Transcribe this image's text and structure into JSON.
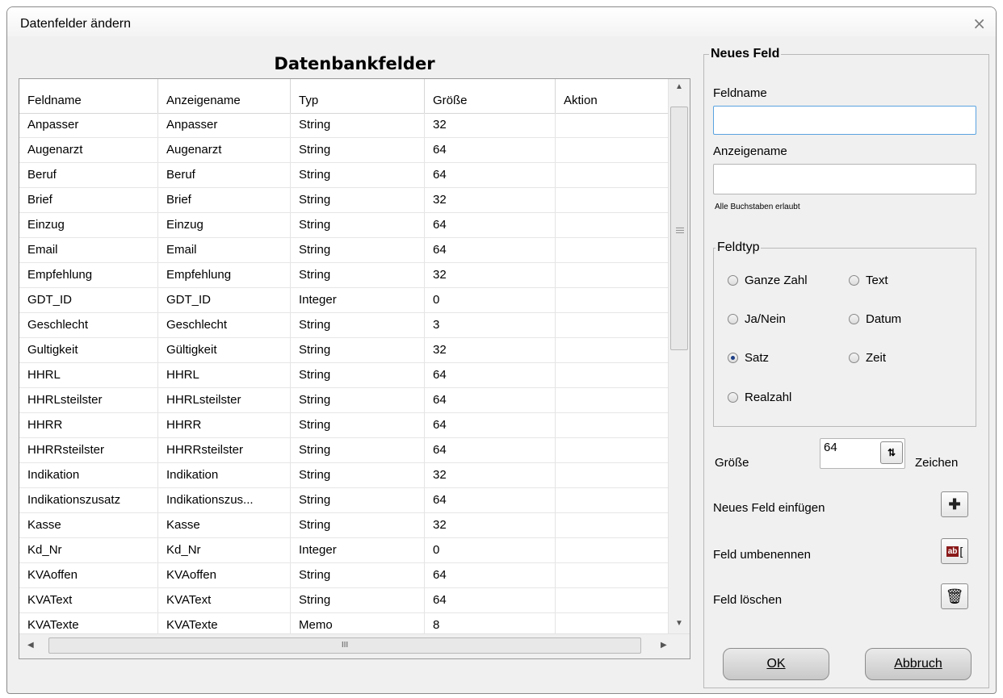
{
  "window": {
    "title": "Datenfelder ändern",
    "close": "×"
  },
  "section_title": "Datenbankfelder",
  "columns": [
    "Feldname",
    "Anzeigename",
    "Typ",
    "Größe",
    "Aktion"
  ],
  "rows": [
    [
      "Anpasser",
      "Anpasser",
      "String",
      "32",
      ""
    ],
    [
      "Augenarzt",
      "Augenarzt",
      "String",
      "64",
      ""
    ],
    [
      "Beruf",
      "Beruf",
      "String",
      "64",
      ""
    ],
    [
      "Brief",
      "Brief",
      "String",
      "32",
      ""
    ],
    [
      "Einzug",
      "Einzug",
      "String",
      "64",
      ""
    ],
    [
      "Email",
      "Email",
      "String",
      "64",
      ""
    ],
    [
      "Empfehlung",
      "Empfehlung",
      "String",
      "32",
      ""
    ],
    [
      "GDT_ID",
      "GDT_ID",
      "Integer",
      "0",
      ""
    ],
    [
      "Geschlecht",
      "Geschlecht",
      "String",
      "3",
      ""
    ],
    [
      "Gultigkeit",
      "Gültigkeit",
      "String",
      "32",
      ""
    ],
    [
      "HHRL",
      "HHRL",
      "String",
      "64",
      ""
    ],
    [
      "HHRLsteilster",
      "HHRLsteilster",
      "String",
      "64",
      ""
    ],
    [
      "HHRR",
      "HHRR",
      "String",
      "64",
      ""
    ],
    [
      "HHRRsteilster",
      "HHRRsteilster",
      "String",
      "64",
      ""
    ],
    [
      "Indikation",
      "Indikation",
      "String",
      "32",
      ""
    ],
    [
      "Indikationszusatz",
      "Indikationszus...",
      "String",
      "64",
      ""
    ],
    [
      "Kasse",
      "Kasse",
      "String",
      "32",
      ""
    ],
    [
      "Kd_Nr",
      "Kd_Nr",
      "Integer",
      "0",
      ""
    ],
    [
      "KVAoffen",
      "KVAoffen",
      "String",
      "64",
      ""
    ],
    [
      "KVAText",
      "KVAText",
      "String",
      "64",
      ""
    ],
    [
      "KVATexte",
      "KVATexte",
      "Memo",
      "8",
      ""
    ]
  ],
  "hscroll_grip": "III",
  "panel": {
    "legend": "Neues Feld",
    "feldname_label": "Feldname",
    "feldname_value": "",
    "anzeigename_label": "Anzeigename",
    "anzeigename_value": "",
    "hint": "Alle Buchstaben erlaubt",
    "feldtyp_legend": "Feldtyp",
    "types": [
      {
        "label": "Ganze Zahl",
        "checked": false
      },
      {
        "label": "Text",
        "checked": false
      },
      {
        "label": "Ja/Nein",
        "checked": false
      },
      {
        "label": "Datum",
        "checked": false
      },
      {
        "label": "Satz",
        "checked": true
      },
      {
        "label": "Zeit",
        "checked": false
      },
      {
        "label": "Realzahl",
        "checked": false
      }
    ],
    "groesse_label": "Größe",
    "groesse_value": "64",
    "zeichen_label": "Zeichen",
    "insert_label": "Neues Feld einfügen",
    "rename_label": "Feld umbenennen",
    "delete_label": "Feld löschen",
    "rename_icon_text": "ab",
    "ok_label": "OK",
    "cancel_label": "Abbruch"
  }
}
